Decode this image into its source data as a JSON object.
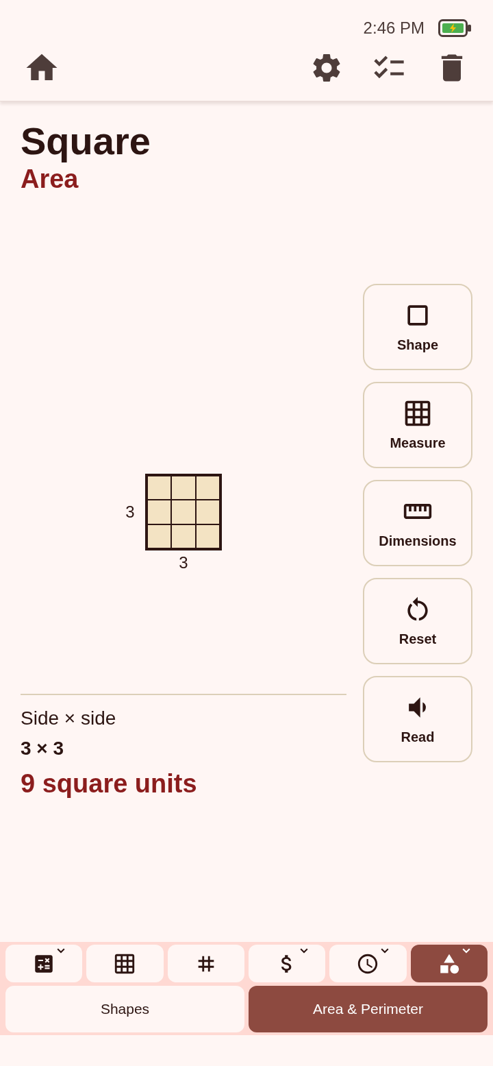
{
  "status_bar": {
    "time": "2:46 PM"
  },
  "header": {
    "title": "Square",
    "subtitle": "Area"
  },
  "figure": {
    "side_label": "3",
    "bottom_label": "3"
  },
  "tools": [
    {
      "label": "Shape"
    },
    {
      "label": "Measure"
    },
    {
      "label": "Dimensions"
    },
    {
      "label": "Reset"
    },
    {
      "label": "Read"
    }
  ],
  "formula": {
    "rule": "Side × side",
    "expression": "3 × 3",
    "result": "9 square units"
  },
  "category_tabs": [
    {
      "selected": false,
      "dropdown": true
    },
    {
      "selected": false,
      "dropdown": false
    },
    {
      "selected": false,
      "dropdown": false
    },
    {
      "selected": false,
      "dropdown": true
    },
    {
      "selected": false,
      "dropdown": true
    },
    {
      "selected": true,
      "dropdown": true
    }
  ],
  "subtabs": [
    {
      "label": "Shapes",
      "selected": false
    },
    {
      "label": "Area & Perimeter",
      "selected": true
    }
  ]
}
